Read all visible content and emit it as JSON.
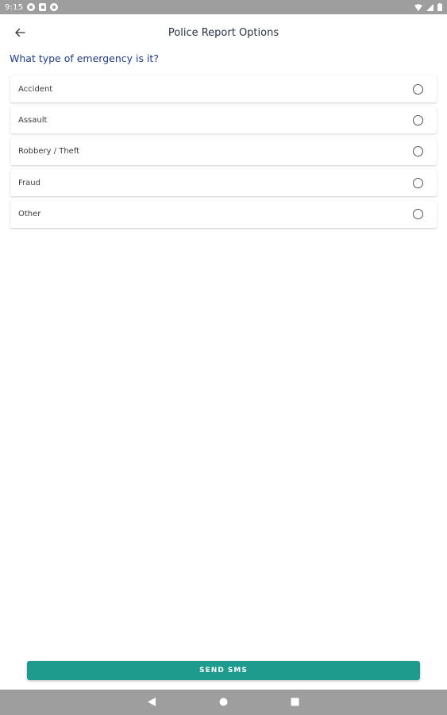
{
  "status_bar": {
    "time": "9:15",
    "icons": [
      "notification-icon",
      "sim-card-icon",
      "notification-icon",
      "wifi-icon",
      "signal-icon",
      "battery-icon"
    ]
  },
  "app_bar": {
    "title": "Police Report Options",
    "back_icon": "arrow-back-icon"
  },
  "question": "What type of emergency is it?",
  "options": [
    {
      "label": "Accident",
      "selected": false
    },
    {
      "label": "Assault",
      "selected": false
    },
    {
      "label": "Robbery / Theft",
      "selected": false
    },
    {
      "label": "Fraud",
      "selected": false
    },
    {
      "label": "Other",
      "selected": false
    }
  ],
  "send_button": {
    "label": "SEND SMS"
  },
  "nav_bar": {
    "icons": [
      "back-triangle-icon",
      "home-circle-icon",
      "recents-square-icon"
    ]
  },
  "colors": {
    "accent": "#1f9b8d",
    "question": "#1f3c8c",
    "system_bars": "#9e9e9e"
  }
}
